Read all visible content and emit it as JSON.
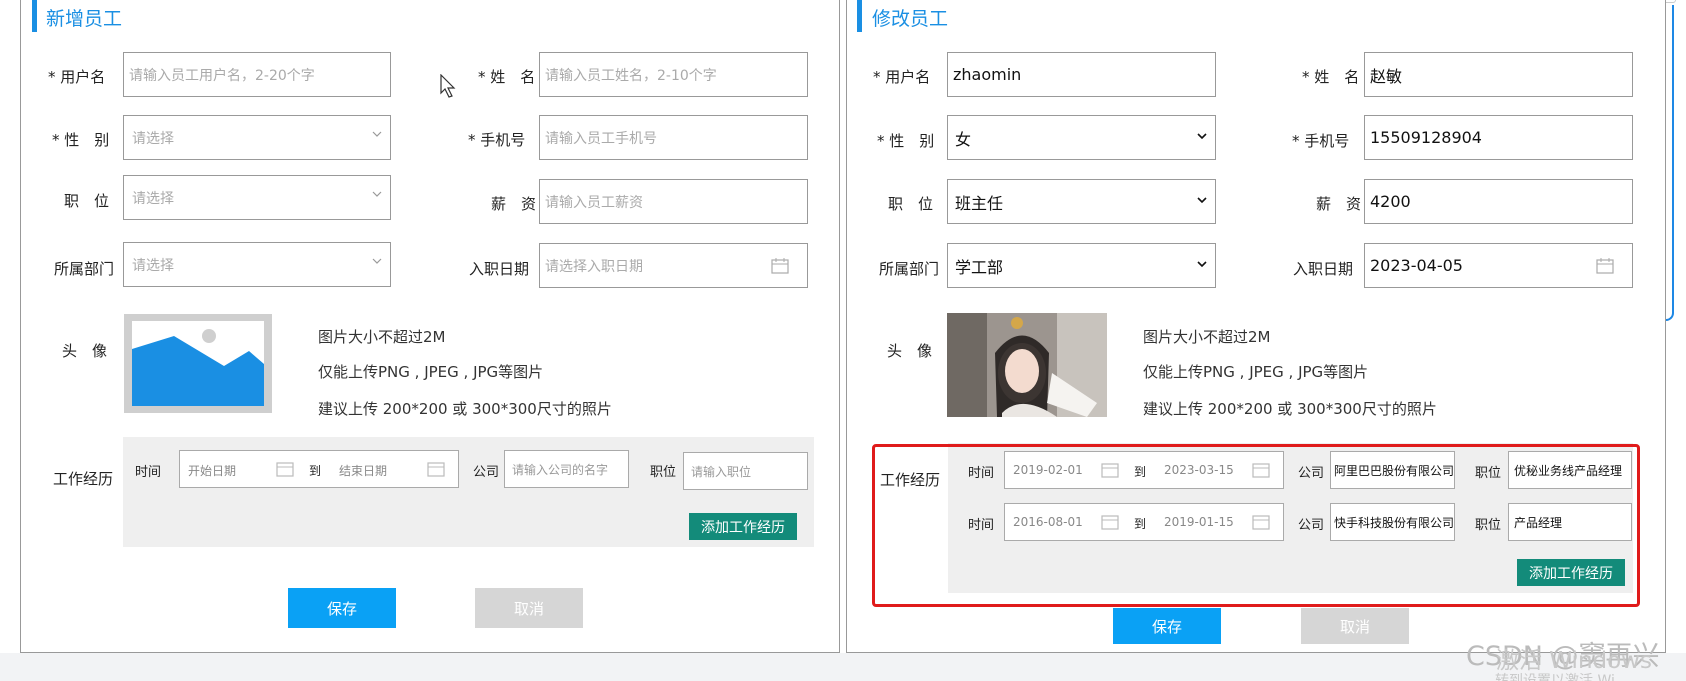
{
  "left_form": {
    "title": "新增员工",
    "username_label": "* 用户名",
    "username_placeholder": "请输入员工用户名，2-20个字",
    "name_label": "* 姓　名",
    "name_placeholder": "请输入员工姓名，2-10个字",
    "gender_label": "* 性　别",
    "gender_value": "请选择",
    "phone_label": "* 手机号",
    "phone_placeholder": "请输入员工手机号",
    "position_label": "职　位",
    "position_value": "请选择",
    "salary_label": "薪　资",
    "salary_placeholder": "请输入员工薪资",
    "dept_label": "所属部门",
    "dept_value": "请选择",
    "entry_date_label": "入职日期",
    "entry_date_placeholder": "请选择入职日期",
    "avatar_label": "头　像",
    "hints": [
      "图片大小不超过2M",
      "仅能上传PNG , JPEG , JPG等图片",
      "建议上传 200*200 或 300*300尺寸的照片"
    ],
    "exp_label": "工作经历",
    "exp_time_label": "时间",
    "exp_start_placeholder": "开始日期",
    "exp_to": "到",
    "exp_end_placeholder": "结束日期",
    "exp_company_label": "公司",
    "exp_company_placeholder": "请输入公司的名字",
    "exp_job_label": "职位",
    "exp_job_placeholder": "请输入职位",
    "add_exp_button": "添加工作经历",
    "save_button": "保存",
    "cancel_button": "取消"
  },
  "right_form": {
    "title": "修改员工",
    "username_label": "* 用户名",
    "username_value": "zhaomin",
    "name_label": "* 姓　名",
    "name_value": "赵敏",
    "gender_label": "* 性　别",
    "gender_value": "女",
    "phone_label": "* 手机号",
    "phone_value": "15509128904",
    "position_label": "职　位",
    "position_value": "班主任",
    "salary_label": "薪　资",
    "salary_value": "4200",
    "dept_label": "所属部门",
    "dept_value": "学工部",
    "entry_date_label": "入职日期",
    "entry_date_value": "2023-04-05",
    "avatar_label": "头　像",
    "hints": [
      "图片大小不超过2M",
      "仅能上传PNG , JPEG , JPG等图片",
      "建议上传 200*200 或 300*300尺寸的照片"
    ],
    "exp_label": "工作经历",
    "experiences": [
      {
        "time_label": "时间",
        "start": "2019-02-01",
        "to": "到",
        "end": "2023-03-15",
        "company_label": "公司",
        "company": "阿里巴巴股份有限公司",
        "job_label": "职位",
        "job": "优秘业务线产品经理"
      },
      {
        "time_label": "时间",
        "start": "2016-08-01",
        "to": "到",
        "end": "2019-01-15",
        "company_label": "公司",
        "company": "快手科技股份有限公司",
        "job_label": "职位",
        "job": "产品经理"
      }
    ],
    "add_exp_button": "添加工作经历",
    "save_button": "保存",
    "cancel_button": "取消"
  },
  "watermark": {
    "csdn": "CSDN @窦再兴",
    "windows": "激活 Windows",
    "windows_sub": "转到设置以激活 Wi"
  },
  "colors": {
    "accent": "#1a8fe3",
    "green": "#138b7a",
    "blue_button": "#0aa1f5",
    "red_frame": "#e01b1b"
  }
}
